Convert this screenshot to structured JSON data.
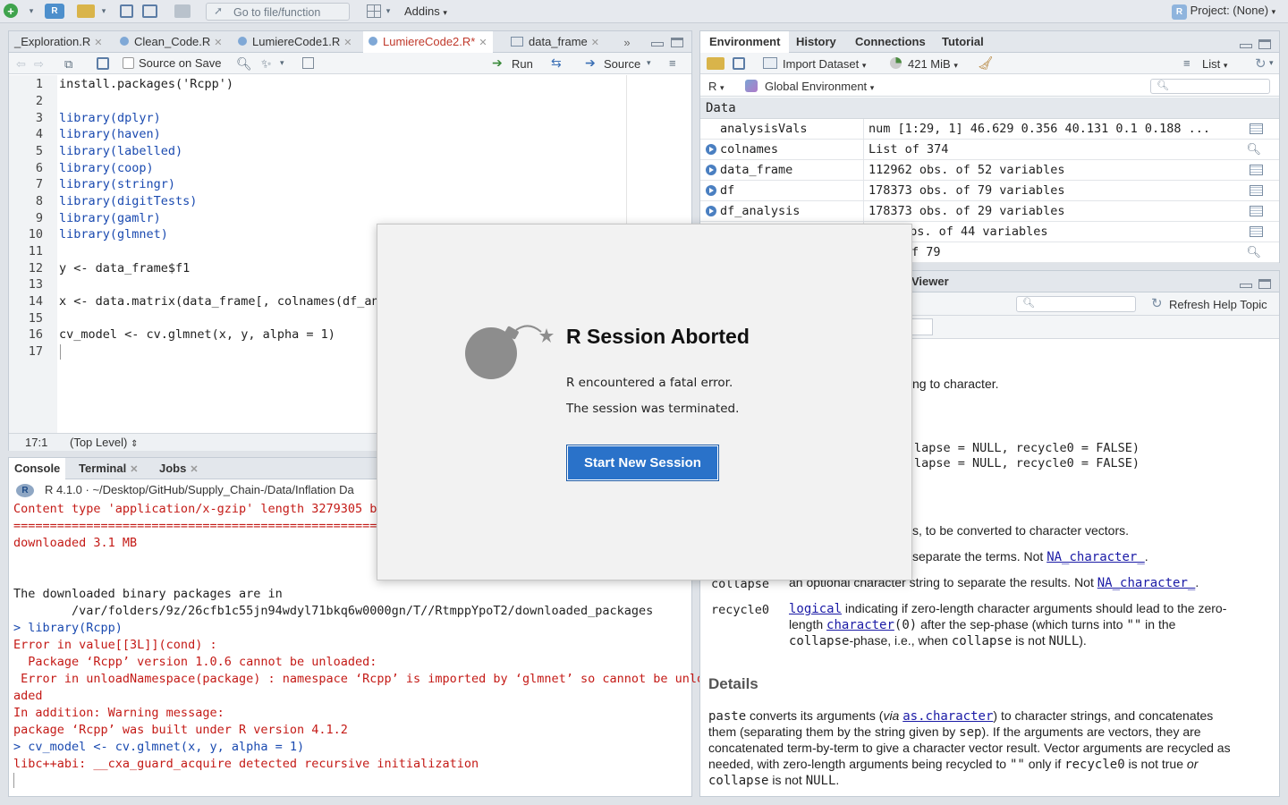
{
  "toolbar": {
    "goto_placeholder": "Go to file/function",
    "addins_label": "Addins",
    "project_label": "Project: (None)"
  },
  "source": {
    "tabs": [
      {
        "label": "_Exploration.R"
      },
      {
        "label": "Clean_Code.R"
      },
      {
        "label": "LumiereCode1.R"
      },
      {
        "label": "LumiereCode2.R*"
      },
      {
        "label": "data_frame"
      }
    ],
    "source_on_save": "Source on Save",
    "run_label": "Run",
    "source_label": "Source",
    "lines": [
      "1",
      "2",
      "3",
      "4",
      "5",
      "6",
      "7",
      "8",
      "9",
      "10",
      "11",
      "12",
      "13",
      "14",
      "15",
      "16",
      "17"
    ],
    "code": {
      "l1": "install.packages('Rcpp')",
      "l3": "library(dplyr)",
      "l4": "library(haven)",
      "l5": "library(labelled)",
      "l6": "library(coop)",
      "l7": "library(stringr)",
      "l8": "library(digitTests)",
      "l9": "library(gamlr)",
      "l10": "library(glmnet)",
      "l12": "y <- data_frame$f1",
      "l14": "x <- data.matrix(data_frame[, colnames(df_ana",
      "l16": "cv_model <- cv.glmnet(x, y, alpha = 1)"
    },
    "status_pos": "17:1",
    "status_scope": "(Top Level)"
  },
  "console": {
    "tabs": [
      {
        "label": "Console"
      },
      {
        "label": "Terminal"
      },
      {
        "label": "Jobs"
      }
    ],
    "path": "R 4.1.0 · ~/Desktop/GitHub/Supply_Chain-/Data/Inflation Da",
    "lines": {
      "c1": "Content type 'application/x-gzip' length 3279305 by",
      "c2": "==================================================",
      "c3": "downloaded 3.1 MB",
      "c4": "The downloaded binary packages are in",
      "c5": "        /var/folders/9z/26cfb1c55jn94wdyl71bkq6w0000gn/T//RtmppYpoT2/downloaded_packages",
      "c6": "> library(Rcpp)",
      "c7": "Error in value[[3L]](cond) :",
      "c8": "  Package ‘Rcpp’ version 1.0.6 cannot be unloaded:",
      "c9": " Error in unloadNamespace(package) : namespace ‘Rcpp’ is imported by ‘glmnet’ so cannot be unlo",
      "c10": "aded",
      "c11": "In addition: Warning message:",
      "c12": "package ‘Rcpp’ was built under R version 4.1.2",
      "c13": "> cv_model <- cv.glmnet(x, y, alpha = 1)",
      "c14": "libc++abi: __cxa_guard_acquire detected recursive initialization"
    }
  },
  "environment": {
    "tabs": [
      {
        "label": "Environment"
      },
      {
        "label": "History"
      },
      {
        "label": "Connections"
      },
      {
        "label": "Tutorial"
      }
    ],
    "import_label": "Import Dataset",
    "memory_label": "421 MiB",
    "list_label": "List",
    "r_label": "R",
    "global_label": "Global Environment",
    "data_header": "Data",
    "rows": [
      {
        "name": "analysisVals",
        "value": "num [1:29, 1] 46.629 0.356 40.131 0.1 0.188 ..."
      },
      {
        "name": "colnames",
        "value": "List of  374"
      },
      {
        "name": "data_frame",
        "value": "112962 obs. of 52 variables"
      },
      {
        "name": "df",
        "value": "178373 obs. of 79 variables"
      },
      {
        "name": "df_analysis",
        "value": "178373 obs. of 29 variables"
      },
      {
        "name": "",
        "value": "obs. of 44 variables"
      },
      {
        "name": "",
        "value": "f  79"
      }
    ]
  },
  "help": {
    "viewer_tab": "Viewer",
    "refresh_label": "Refresh Help Topic",
    "t1": "ng to character.",
    "t2": "lapse = NULL, recycle0 = FALSE)",
    "t3": "lapse = NULL, recycle0 = FALSE)",
    "t4": "s, to be converted to character vectors.",
    "t5a": "separate the terms. Not ",
    "t5b": "NA_character_",
    "t5c": ".",
    "collapse_term": "collapse",
    "collapse_desc": "an optional character string to separate the results. Not ",
    "collapse_link": "NA_character_",
    "recycle_term": "recycle0",
    "recycle_link": "logical",
    "recycle_d1": " indicating if zero-length character arguments should lead to the zero-",
    "recycle_d2a": "length ",
    "recycle_d2b": "character",
    "recycle_d2c": "(0)",
    "recycle_d2d": " after the sep-phase (which turns into ",
    "recycle_d2e": "\"\"",
    "recycle_d2f": " in the",
    "recycle_d3a": "collapse",
    "recycle_d3b": "-phase, i.e., when ",
    "recycle_d3c": "collapse",
    "recycle_d3d": " is not ",
    "recycle_d3e": "NULL",
    "recycle_d3f": ").",
    "details_heading": "Details",
    "d1a": "paste",
    "d1b": " converts its arguments (",
    "d1c": "via",
    "d1d": " ",
    "d1e": "as.character",
    "d1f": ") to character strings, and concatenates",
    "d2a": "them (separating them by the string given by ",
    "d2b": "sep",
    "d2c": "). If the arguments are vectors, they are",
    "d3": "concatenated term-by-term to give a character vector result. Vector arguments are recycled as",
    "d4a": "needed, with zero-length arguments being recycled to ",
    "d4b": "\"\"",
    "d4c": " only if ",
    "d4d": "recycle0",
    "d4e": " is not true ",
    "d4f": "or",
    "d5a": "collapse",
    "d5b": " is not ",
    "d5c": "NULL",
    "d5d": "."
  },
  "dialog": {
    "title": "R Session Aborted",
    "line1": "R encountered a fatal error.",
    "line2": "The session was terminated.",
    "button": "Start New Session",
    "accent": "#2a72c9"
  }
}
